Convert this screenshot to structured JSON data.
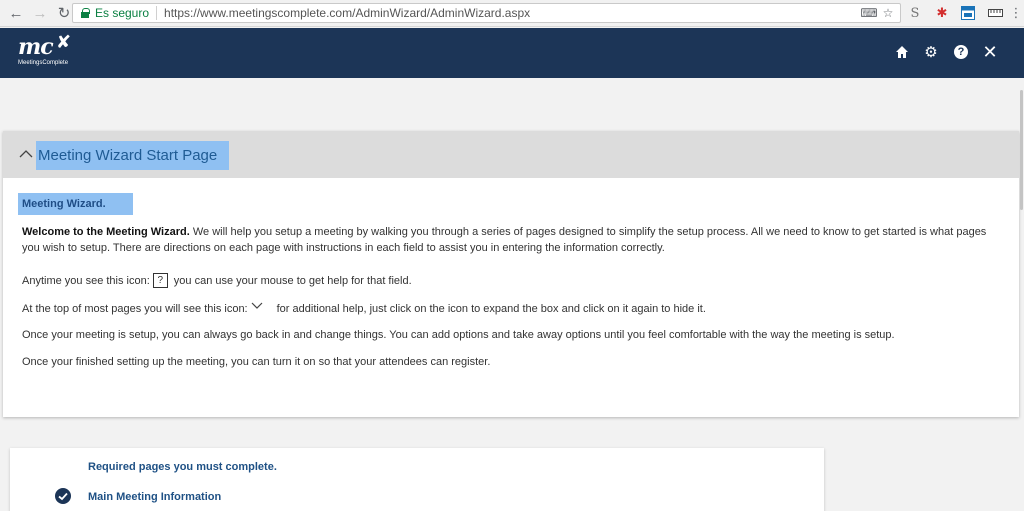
{
  "browser": {
    "secure_label": "Es seguro",
    "url": "https://www.meetingscomplete.com/AdminWizard/AdminWizard.aspx"
  },
  "header": {
    "logo_mark": "mc",
    "logo_sub": "MeetingsComplete",
    "icons": [
      "home-icon",
      "gear-icon",
      "help-icon",
      "close-icon"
    ],
    "color": "#1c3557"
  },
  "wizard": {
    "title": "Meeting Wizard Start Page",
    "intro_badge": "Meeting Wizard.",
    "welcome_bold": "Welcome to the Meeting Wizard.",
    "welcome_rest": " We will help you setup a meeting by walking you through a series of pages designed to simplify the setup process. All we need to know to get started is what pages you wish to setup. There are directions on each page with instructions in each field to assist you in entering the information correctly.",
    "help_before": "Anytime you see this icon:",
    "help_icon_glyph": "?",
    "help_after": "you can use your mouse to get help for that field.",
    "expand_before": "At the top of most pages you will see this icon:",
    "expand_after": "for additional help, just click on the icon to expand the box and click on it again to hide it.",
    "change_text": "Once your meeting is setup, you can always go back in and change things. You can add options and take away options until you feel comfortable with the way the meeting is setup.",
    "finish_text": "Once your finished setting up the meeting, you can turn it on so that your attendees can register.",
    "highlight_color": "#8fc0f2"
  },
  "required": {
    "title": "Required pages you must complete.",
    "items": [
      {
        "label": "Main Meeting Information",
        "checked": true
      }
    ]
  }
}
